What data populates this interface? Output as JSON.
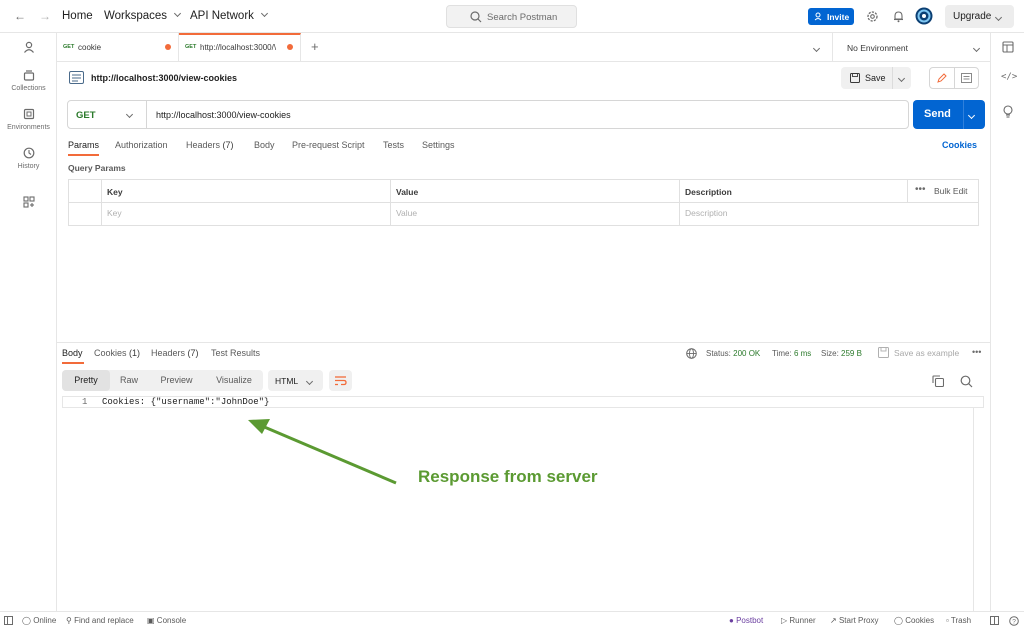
{
  "header": {
    "home": "Home",
    "workspaces": "Workspaces",
    "api_network": "API Network",
    "search_placeholder": "Search Postman",
    "invite": "Invite",
    "upgrade": "Upgrade"
  },
  "sidebar": {
    "items": [
      {
        "label": ""
      },
      {
        "label": "Collections"
      },
      {
        "label": "Environments"
      },
      {
        "label": "History"
      },
      {
        "label": ""
      }
    ]
  },
  "tabs": [
    {
      "method": "GET",
      "label": "cookie"
    },
    {
      "method": "GET",
      "label": "http://localhost:3000/\\"
    }
  ],
  "environment": "No Environment",
  "request": {
    "title": "http://localhost:3000/view-cookies",
    "save_label": "Save",
    "method": "GET",
    "url": "http://localhost:3000/view-cookies",
    "send_label": "Send",
    "subtabs": {
      "params": "Params",
      "authorization": "Authorization",
      "headers": "Headers",
      "headers_count": "(7)",
      "body": "Body",
      "prerequest": "Pre-request Script",
      "tests": "Tests",
      "settings": "Settings",
      "cookies": "Cookies"
    },
    "query_params_label": "Query Params",
    "params_table": {
      "headers": [
        "Key",
        "Value",
        "Description"
      ],
      "bulk_edit": "Bulk Edit",
      "placeholders": [
        "Key",
        "Value",
        "Description"
      ]
    }
  },
  "response": {
    "tabs": {
      "body": "Body",
      "cookies": "Cookies",
      "cookies_count": "(1)",
      "headers": "Headers",
      "headers_count": "(7)",
      "test_results": "Test Results"
    },
    "status_label": "Status:",
    "status_value": "200 OK",
    "time_label": "Time:",
    "time_value": "6 ms",
    "size_label": "Size:",
    "size_value": "259 B",
    "save_example": "Save as example",
    "views": [
      "Pretty",
      "Raw",
      "Preview",
      "Visualize"
    ],
    "format": "HTML",
    "line_number": "1",
    "body_line": "Cookies: {\"username\":\"JohnDoe\"}",
    "annotation": "Response from server"
  },
  "statusbar": {
    "online": "Online",
    "find_replace": "Find and replace",
    "console": "Console",
    "postbot": "Postbot",
    "runner": "Runner",
    "start_proxy": "Start Proxy",
    "cookies": "Cookies",
    "trash": "Trash"
  },
  "colors": {
    "accent_blue": "#0265d2",
    "tab_orange": "#f26b3a",
    "status_green": "#2b7a2b",
    "annotation_green": "#5b9a32",
    "postbot_purple": "#6b3fa0"
  }
}
